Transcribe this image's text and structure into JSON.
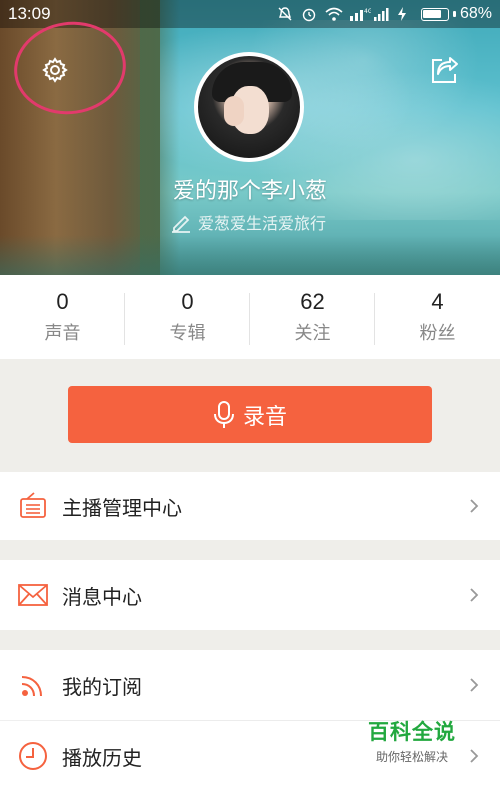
{
  "status_bar": {
    "time": "13:09",
    "network": "4G",
    "battery": "68%"
  },
  "profile": {
    "username": "爱的那个李小葱",
    "bio": "爱葱爱生活爱旅行"
  },
  "stats": [
    {
      "value": "0",
      "label": "声音"
    },
    {
      "value": "0",
      "label": "专辑"
    },
    {
      "value": "62",
      "label": "关注"
    },
    {
      "value": "4",
      "label": "粉丝"
    }
  ],
  "record": {
    "label": "录音"
  },
  "menu": {
    "items": [
      {
        "label": "主播管理中心",
        "icon": "radio-icon"
      },
      {
        "label": "消息中心",
        "icon": "envelope-icon"
      },
      {
        "label": "我的订阅",
        "icon": "rss-icon"
      },
      {
        "label": "播放历史",
        "icon": "clock-icon"
      }
    ]
  },
  "watermark": {
    "title": "百科全说",
    "subtitle": "助你轻松解决"
  },
  "colors": {
    "accent": "#f5623f",
    "annotation_circle": "#e23a6c",
    "watermark": "#22a83f"
  }
}
